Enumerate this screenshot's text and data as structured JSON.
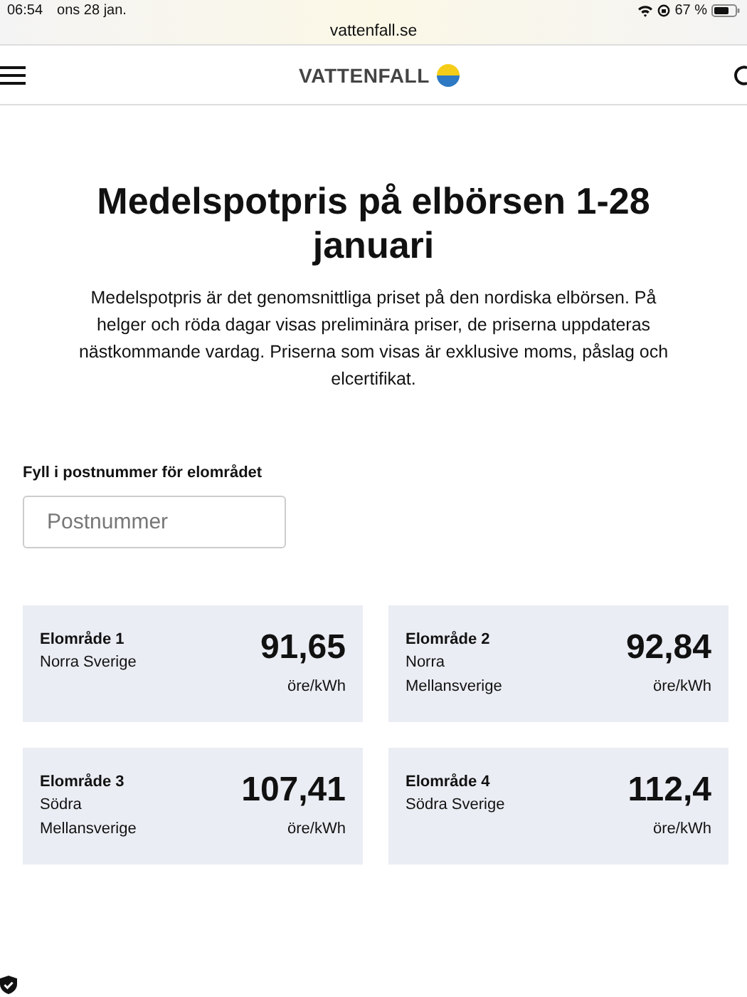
{
  "status_bar": {
    "time": "06:54",
    "date": "ons 28 jan.",
    "battery": "67 %"
  },
  "browser": {
    "url": "vattenfall.se"
  },
  "header": {
    "logo": "VATTENFALL"
  },
  "title": "Medelspotpris på elbörsen 1-28 januari",
  "intro": "Medelspotpris är det genomsnittliga priset på den nordiska elbörsen. På helger och röda dagar visas preliminära priser, de priserna uppdateras nästkommande vardag. Priserna som visas är exklusive moms, påslag och elcertifikat.",
  "postcode": {
    "label": "Fyll i postnummer för elområdet",
    "placeholder": "Postnummer"
  },
  "areas": [
    {
      "name": "Elområde 1",
      "region": "Norra Sverige",
      "price": "91,65",
      "unit": "öre/kWh"
    },
    {
      "name": "Elområde 2",
      "region": "Norra Mellansverige",
      "price": "92,84",
      "unit": "öre/kWh"
    },
    {
      "name": "Elområde 3",
      "region": "Södra Mellansverige",
      "price": "107,41",
      "unit": "öre/kWh"
    },
    {
      "name": "Elområde 4",
      "region": "Södra Sverige",
      "price": "112,4",
      "unit": "öre/kWh"
    }
  ]
}
